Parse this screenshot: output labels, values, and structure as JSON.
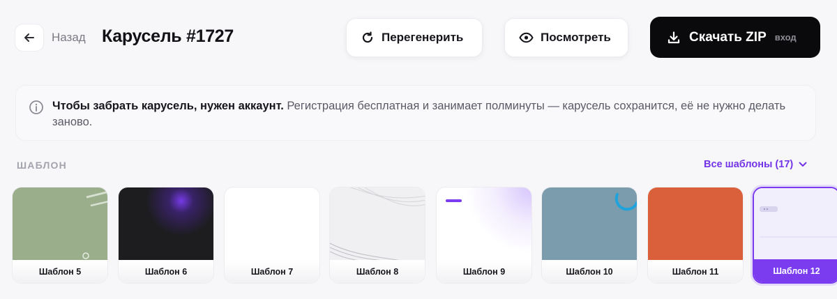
{
  "header": {
    "back_label": "Назад",
    "title": "Карусель #1727",
    "regenerate_label": "Перегенерить",
    "view_label": "Посмотреть",
    "download_label": "Скачать ZIP",
    "download_note": "вход"
  },
  "notice": {
    "bold_text": "Чтобы забрать карусель, нужен аккаунт.",
    "text": " Регистрация бесплатная и занимает полминуты — карусель сохранится, её не нужно делать заново."
  },
  "templates": {
    "section_label": "ШАБЛОН",
    "all_link": "Все шаблоны (17)",
    "items": [
      {
        "label": "Шаблон 5",
        "color": "#9aae8c"
      },
      {
        "label": "Шаблон 6",
        "color": "#1d1d20"
      },
      {
        "label": "Шаблон 7",
        "color": "#ffffff"
      },
      {
        "label": "Шаблон 8",
        "color": "#f0f0f2"
      },
      {
        "label": "Шаблон 9",
        "color": "#ffffff"
      },
      {
        "label": "Шаблон 10",
        "color": "#7a9cad"
      },
      {
        "label": "Шаблон 11",
        "color": "#d9603a"
      },
      {
        "label": "Шаблон 12",
        "color": "#f1effc"
      }
    ],
    "selected_index": 7
  },
  "colors": {
    "accent": "#7b3cf0",
    "dark_button": "#0a0a0c",
    "background": "#f7f7f9"
  },
  "icons": {
    "back": "arrow-left-icon",
    "regenerate": "refresh-icon",
    "view": "eye-icon",
    "download": "download-icon",
    "info": "info-icon",
    "dropdown": "chevron-down-icon"
  }
}
